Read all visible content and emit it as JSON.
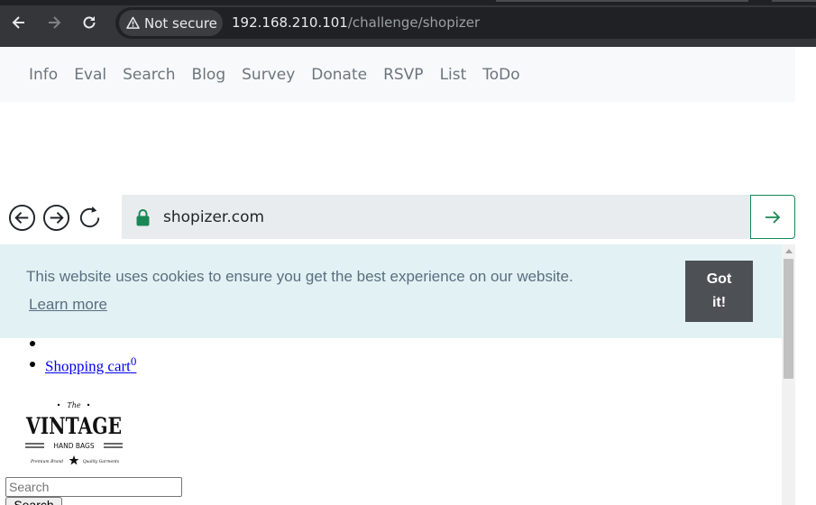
{
  "browser": {
    "security_label": "Not secure",
    "url_host": "192.168.210.101",
    "url_path": "/challenge/shopizer"
  },
  "challenge_nav": {
    "items": [
      "Info",
      "Eval",
      "Search",
      "Blog",
      "Survey",
      "Donate",
      "RSVP",
      "List",
      "ToDo"
    ]
  },
  "inner_browser": {
    "address": "shopizer.com"
  },
  "cookie_banner": {
    "message": "This website uses cookies to ensure you get the best experience on our website.",
    "learn_more": "Learn more",
    "button_line1": "Got",
    "button_line2": "it!"
  },
  "store": {
    "cart_label": "Shopping cart",
    "cart_count": "0",
    "logo_top": "The",
    "logo_main": "VINTAGE",
    "logo_sub": "HAND BAGS",
    "logo_left": "Premium Brand",
    "logo_right": "Quality Garments",
    "search_placeholder": "Search",
    "search_button": "Search"
  },
  "colors": {
    "chrome_bg": "#35363a",
    "nav_bg": "#f8f9fa",
    "cookie_bg": "#e2f2f4",
    "cookie_button": "#4d5055",
    "go_border": "#198754"
  }
}
